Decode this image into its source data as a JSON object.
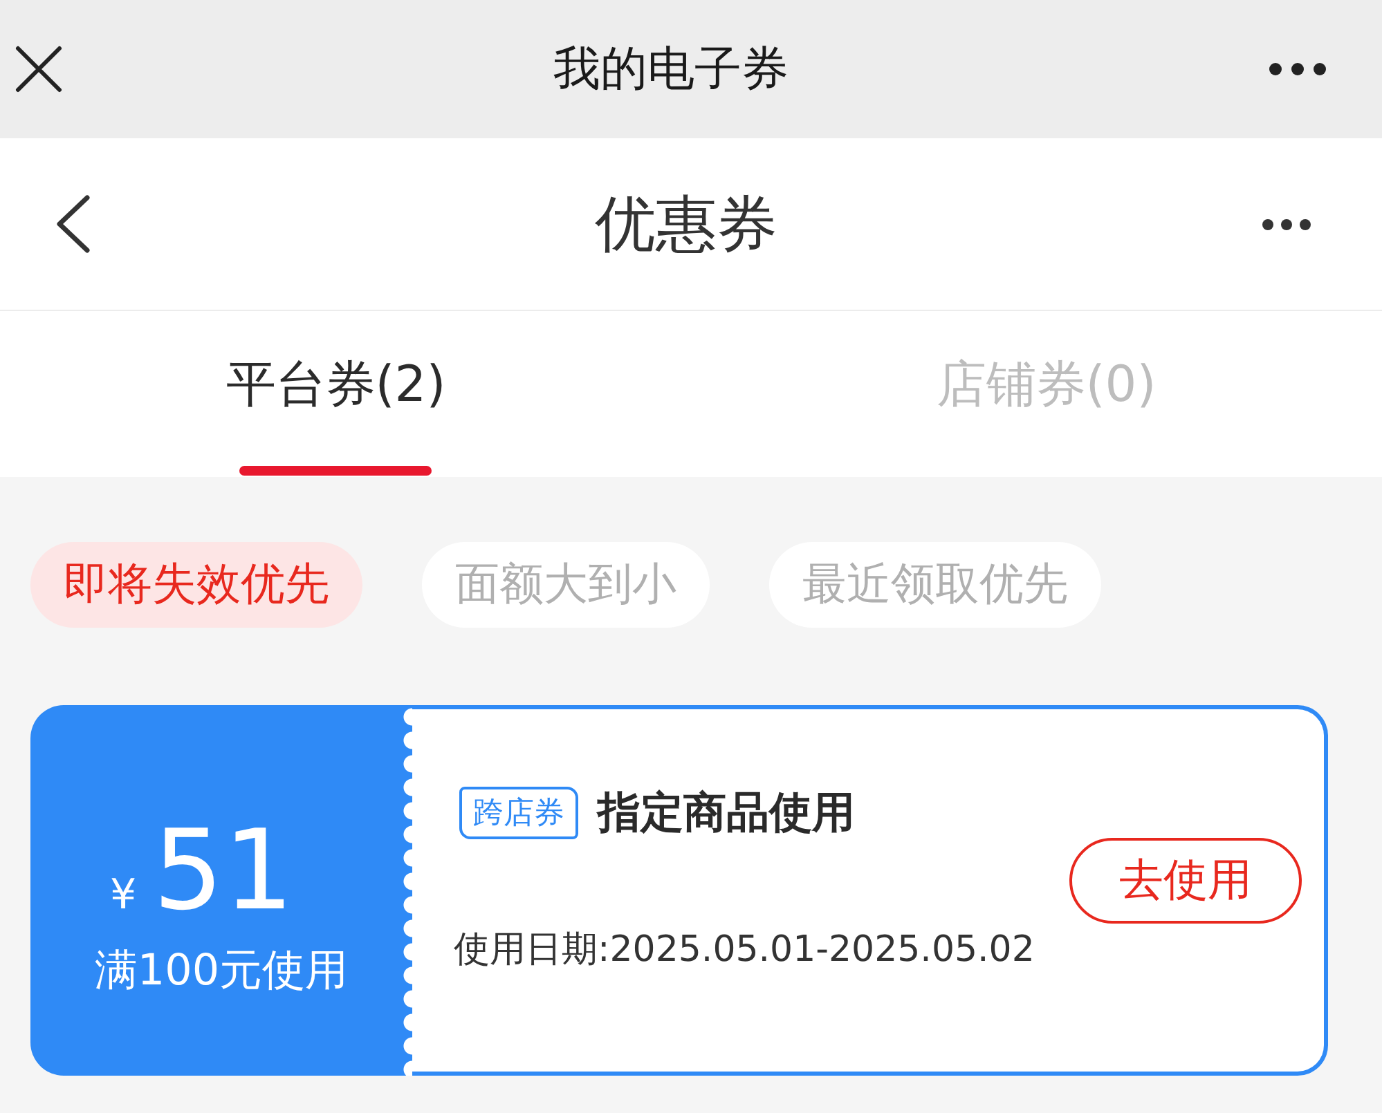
{
  "top_bar": {
    "title": "我的电子券"
  },
  "header": {
    "title": "优惠券"
  },
  "tabs": [
    {
      "label": "平台券(2)",
      "selected": true
    },
    {
      "label": "店铺券(0)",
      "selected": false
    }
  ],
  "sort_options": [
    {
      "label": "即将失效优先",
      "selected": true
    },
    {
      "label": "面额大到小",
      "selected": false
    },
    {
      "label": "最近领取优先",
      "selected": false
    }
  ],
  "coupons": [
    {
      "currency": "¥",
      "amount": "51",
      "threshold": "满100元使用",
      "tag": "跨店券",
      "title": "指定商品使用",
      "validity": "使用日期:2025.05.01-2025.05.02",
      "action": "去使用"
    }
  ]
}
